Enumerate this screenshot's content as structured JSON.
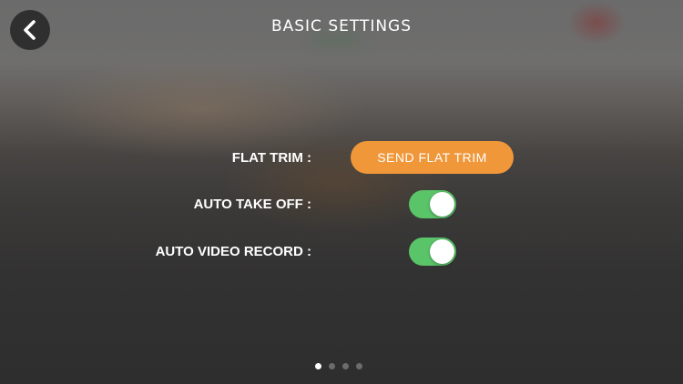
{
  "header": {
    "title": "BASIC SETTINGS",
    "back_icon": "chevron-left-icon"
  },
  "settings": {
    "flat_trim": {
      "label": "FLAT TRIM :",
      "button_label": "SEND FLAT TRIM",
      "button_color": "#f0973a"
    },
    "auto_take_off": {
      "label": "AUTO TAKE OFF :",
      "enabled": true
    },
    "auto_video_record": {
      "label": "AUTO VIDEO RECORD :",
      "enabled": true
    },
    "toggle_on_color": "#5ac469"
  },
  "pagination": {
    "total": 4,
    "current": 1
  }
}
